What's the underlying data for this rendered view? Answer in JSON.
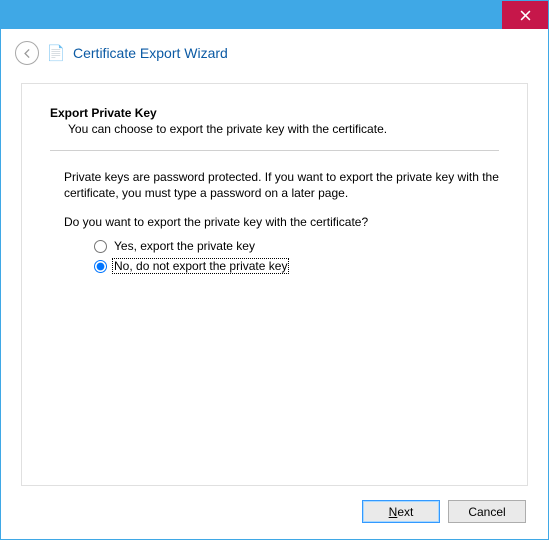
{
  "titlebar": {
    "close_label": "Close"
  },
  "header": {
    "title": "Certificate Export Wizard"
  },
  "content": {
    "section_title": "Export Private Key",
    "section_sub": "You can choose to export the private key with the certificate.",
    "body_text": "Private keys are password protected. If you want to export the private key with the certificate, you must type a password on a later page.",
    "prompt": "Do you want to export the private key with the certificate?",
    "options": {
      "yes": {
        "label": "Yes, export the private key",
        "selected": false
      },
      "no": {
        "prefix": "N",
        "rest": "o, do not export the private key",
        "selected": true
      }
    }
  },
  "footer": {
    "next": {
      "prefix": "N",
      "rest": "ext"
    },
    "cancel": "Cancel"
  }
}
